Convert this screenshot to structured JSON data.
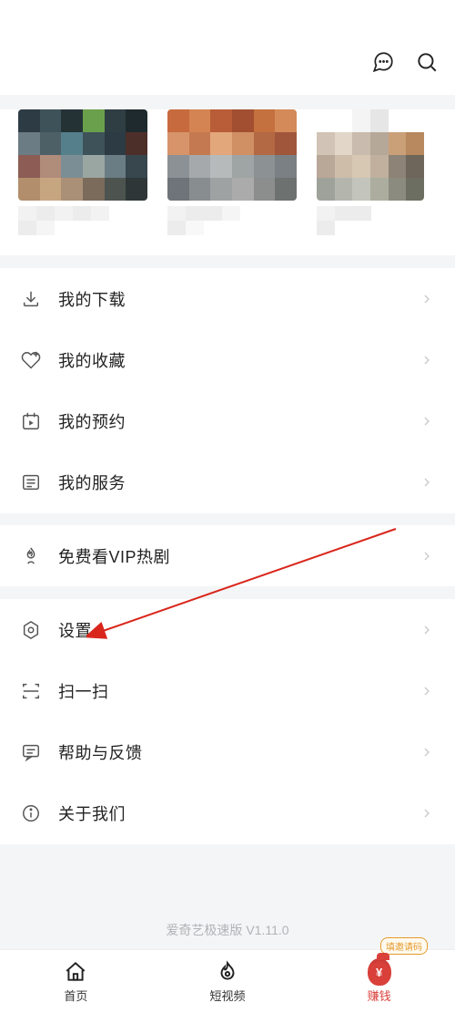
{
  "header": {},
  "menu": {
    "groups": [
      [
        {
          "key": "downloads",
          "label": "我的下载",
          "icon": "download-icon"
        },
        {
          "key": "favorites",
          "label": "我的收藏",
          "icon": "heart-plus-icon"
        },
        {
          "key": "reservations",
          "label": "我的预约",
          "icon": "calendar-icon"
        },
        {
          "key": "services",
          "label": "我的服务",
          "icon": "list-icon"
        }
      ],
      [
        {
          "key": "vip-free",
          "label": "免费看VIP热剧",
          "icon": "flame-icon"
        }
      ],
      [
        {
          "key": "settings",
          "label": "设置",
          "icon": "hex-gear-icon"
        },
        {
          "key": "scan",
          "label": "扫一扫",
          "icon": "scan-icon"
        },
        {
          "key": "feedback",
          "label": "帮助与反馈",
          "icon": "comment-icon"
        },
        {
          "key": "about",
          "label": "关于我们",
          "icon": "info-icon"
        }
      ]
    ]
  },
  "version_text": "爱奇艺极速版 V1.11.0",
  "tabbar": {
    "items": [
      {
        "key": "home",
        "label": "首页",
        "icon": "home-icon"
      },
      {
        "key": "shorts",
        "label": "短视频",
        "icon": "fire-drop-icon"
      },
      {
        "key": "earn",
        "label": "赚钱",
        "icon": "money-bag-icon",
        "promo": "填邀请码"
      }
    ]
  },
  "annotation": {
    "type": "red-arrow",
    "target_row_key": "settings"
  }
}
